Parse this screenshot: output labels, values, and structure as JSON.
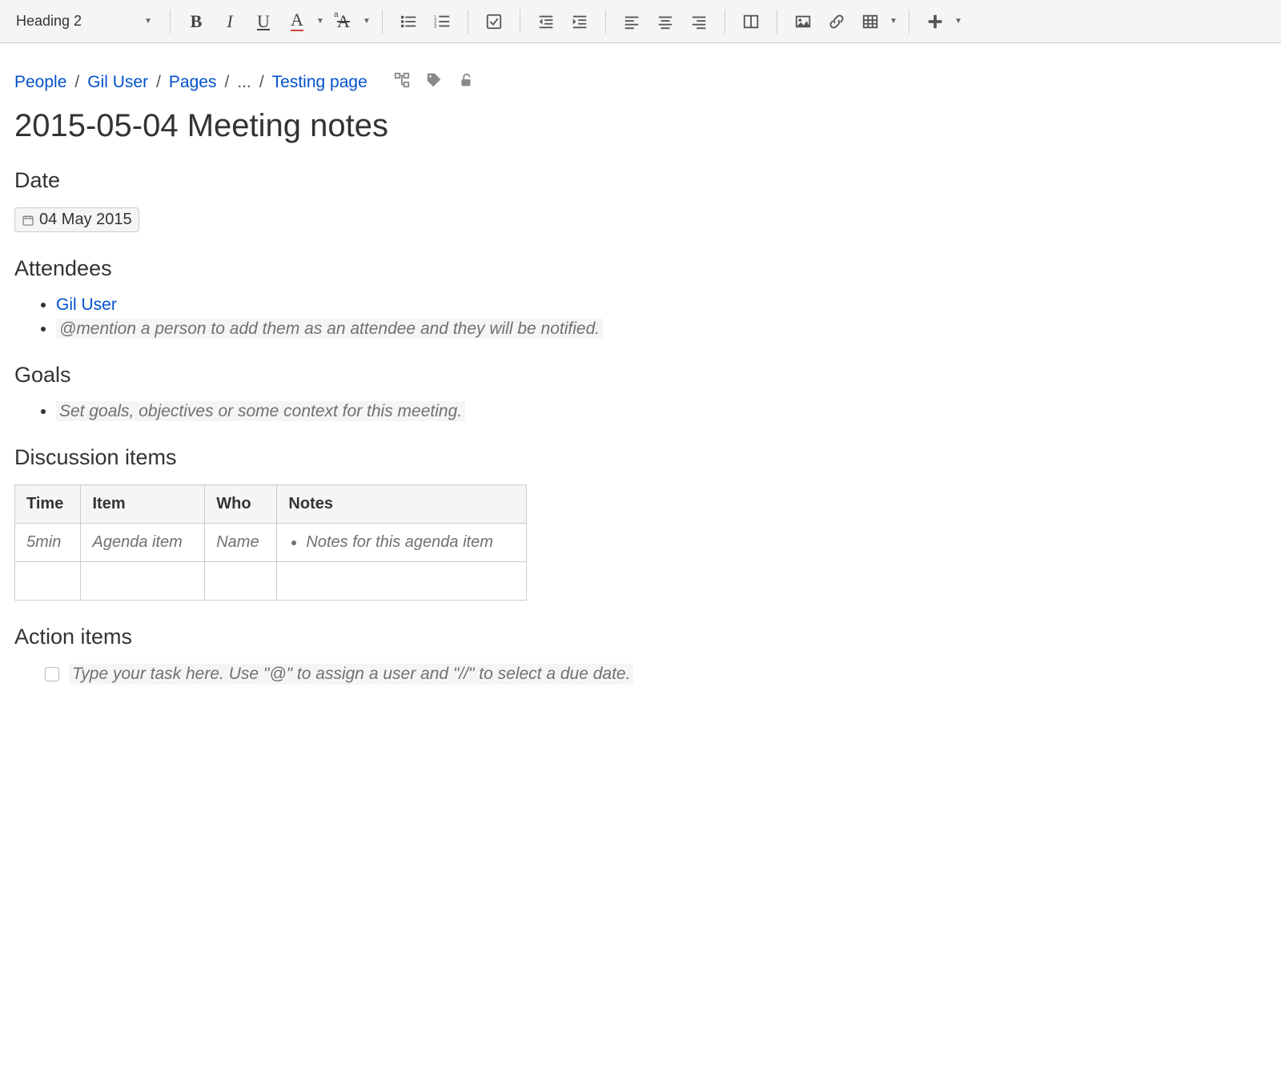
{
  "toolbar": {
    "style_label": "Heading 2"
  },
  "breadcrumb": {
    "items": [
      "People",
      "Gil User",
      "Pages",
      "...",
      "Testing page"
    ]
  },
  "page": {
    "title": "2015-05-04 Meeting notes"
  },
  "sections": {
    "date": {
      "heading": "Date",
      "value": "04 May 2015"
    },
    "attendees": {
      "heading": "Attendees",
      "items": [
        {
          "text": "Gil User",
          "is_link": true
        },
        {
          "text": "@mention a person to add them as an attendee and they will be notified.",
          "is_placeholder": true
        }
      ]
    },
    "goals": {
      "heading": "Goals",
      "items": [
        {
          "text": "Set goals, objectives or some context for this meeting.",
          "is_placeholder": true
        }
      ]
    },
    "discussion": {
      "heading": "Discussion items",
      "columns": [
        "Time",
        "Item",
        "Who",
        "Notes"
      ],
      "rows": [
        {
          "time": "5min",
          "item": "Agenda item",
          "who": "Name",
          "notes": "Notes for this agenda item",
          "placeholder": true
        },
        {
          "time": "",
          "item": "",
          "who": "",
          "notes": "",
          "empty": true
        }
      ]
    },
    "action": {
      "heading": "Action items",
      "task_placeholder": "Type your task here. Use \"@\" to assign a user and \"//\" to select a due date."
    }
  }
}
